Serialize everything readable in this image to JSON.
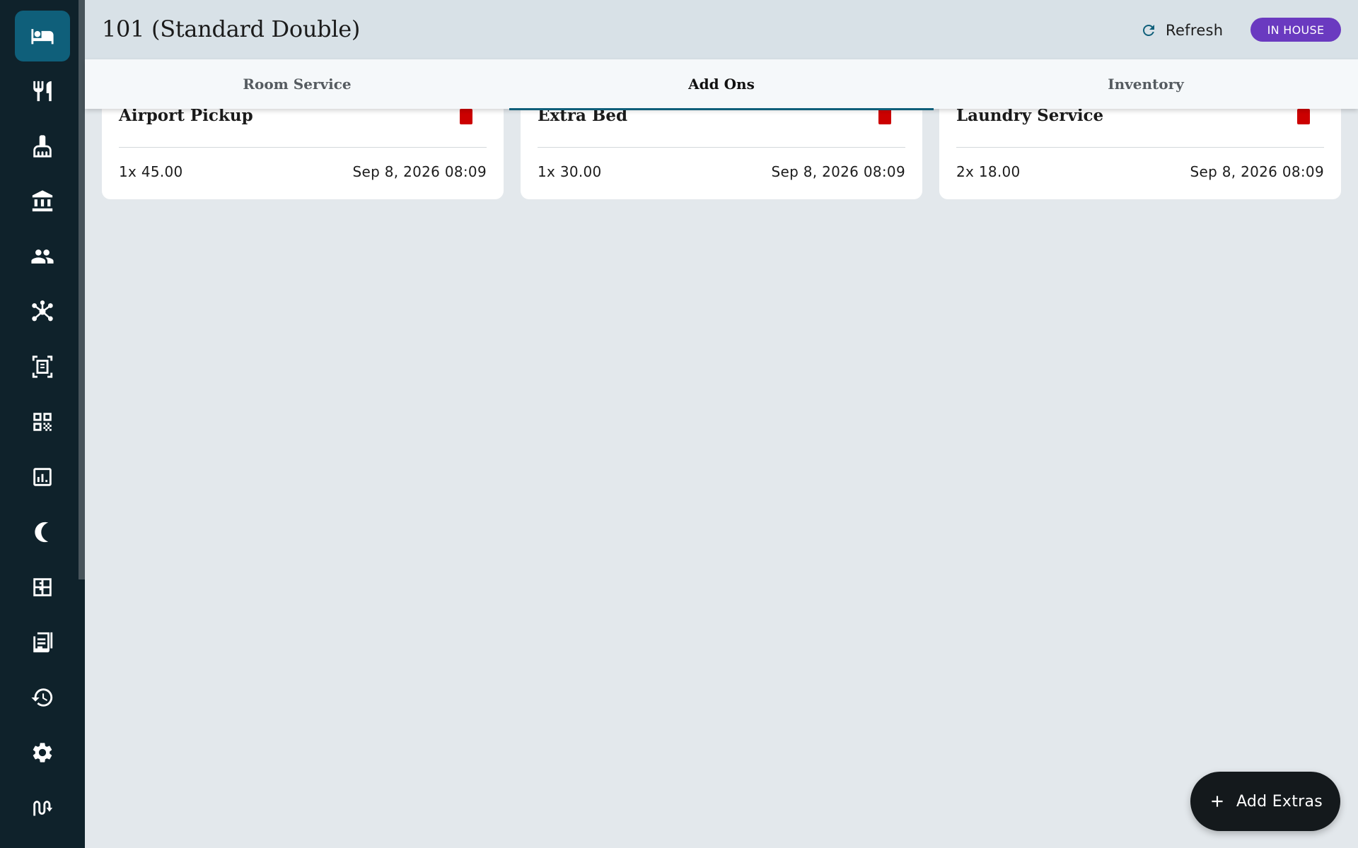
{
  "sidebar": {
    "items": [
      {
        "icon": "bed-icon",
        "active": true
      },
      {
        "icon": "restaurant-icon",
        "active": false
      },
      {
        "icon": "cleaning-icon",
        "active": false
      },
      {
        "icon": "building-icon",
        "active": false
      },
      {
        "icon": "people-icon",
        "active": false
      },
      {
        "icon": "network-icon",
        "active": false
      },
      {
        "icon": "document-scan-icon",
        "active": false
      },
      {
        "icon": "qr-code-icon",
        "active": false
      },
      {
        "icon": "report-chart-icon",
        "active": false
      },
      {
        "icon": "night-audit-icon",
        "active": false
      },
      {
        "icon": "floor-plan-icon",
        "active": false
      },
      {
        "icon": "receipt-icon",
        "active": false
      },
      {
        "icon": "history-icon",
        "active": false
      },
      {
        "icon": "settings-icon",
        "active": false
      },
      {
        "icon": "logout-icon",
        "active": false
      }
    ]
  },
  "header": {
    "title": "101 (Standard Double)",
    "refresh_label": "Refresh",
    "status_badge": "IN HOUSE"
  },
  "tabs": [
    {
      "label": "Room Service",
      "active": false
    },
    {
      "label": "Add Ons",
      "active": true
    },
    {
      "label": "Inventory",
      "active": false
    }
  ],
  "cards": [
    {
      "title": "Airport Pickup",
      "qty_price": "1x 45.00",
      "date": "Sep 8, 2026 08:09"
    },
    {
      "title": "Extra Bed",
      "qty_price": "1x 30.00",
      "date": "Sep 8, 2026 08:09"
    },
    {
      "title": "Laundry Service",
      "qty_price": "2x 18.00",
      "date": "Sep 8, 2026 08:09"
    }
  ],
  "fab": {
    "label": "Add Extras",
    "icon": "plus-icon"
  },
  "colors": {
    "sidebar_bg": "#0f222b",
    "accent": "#0f5f7a",
    "badge": "#6a3ac0",
    "delete": "#cc0000",
    "fab_bg": "#14191c"
  }
}
